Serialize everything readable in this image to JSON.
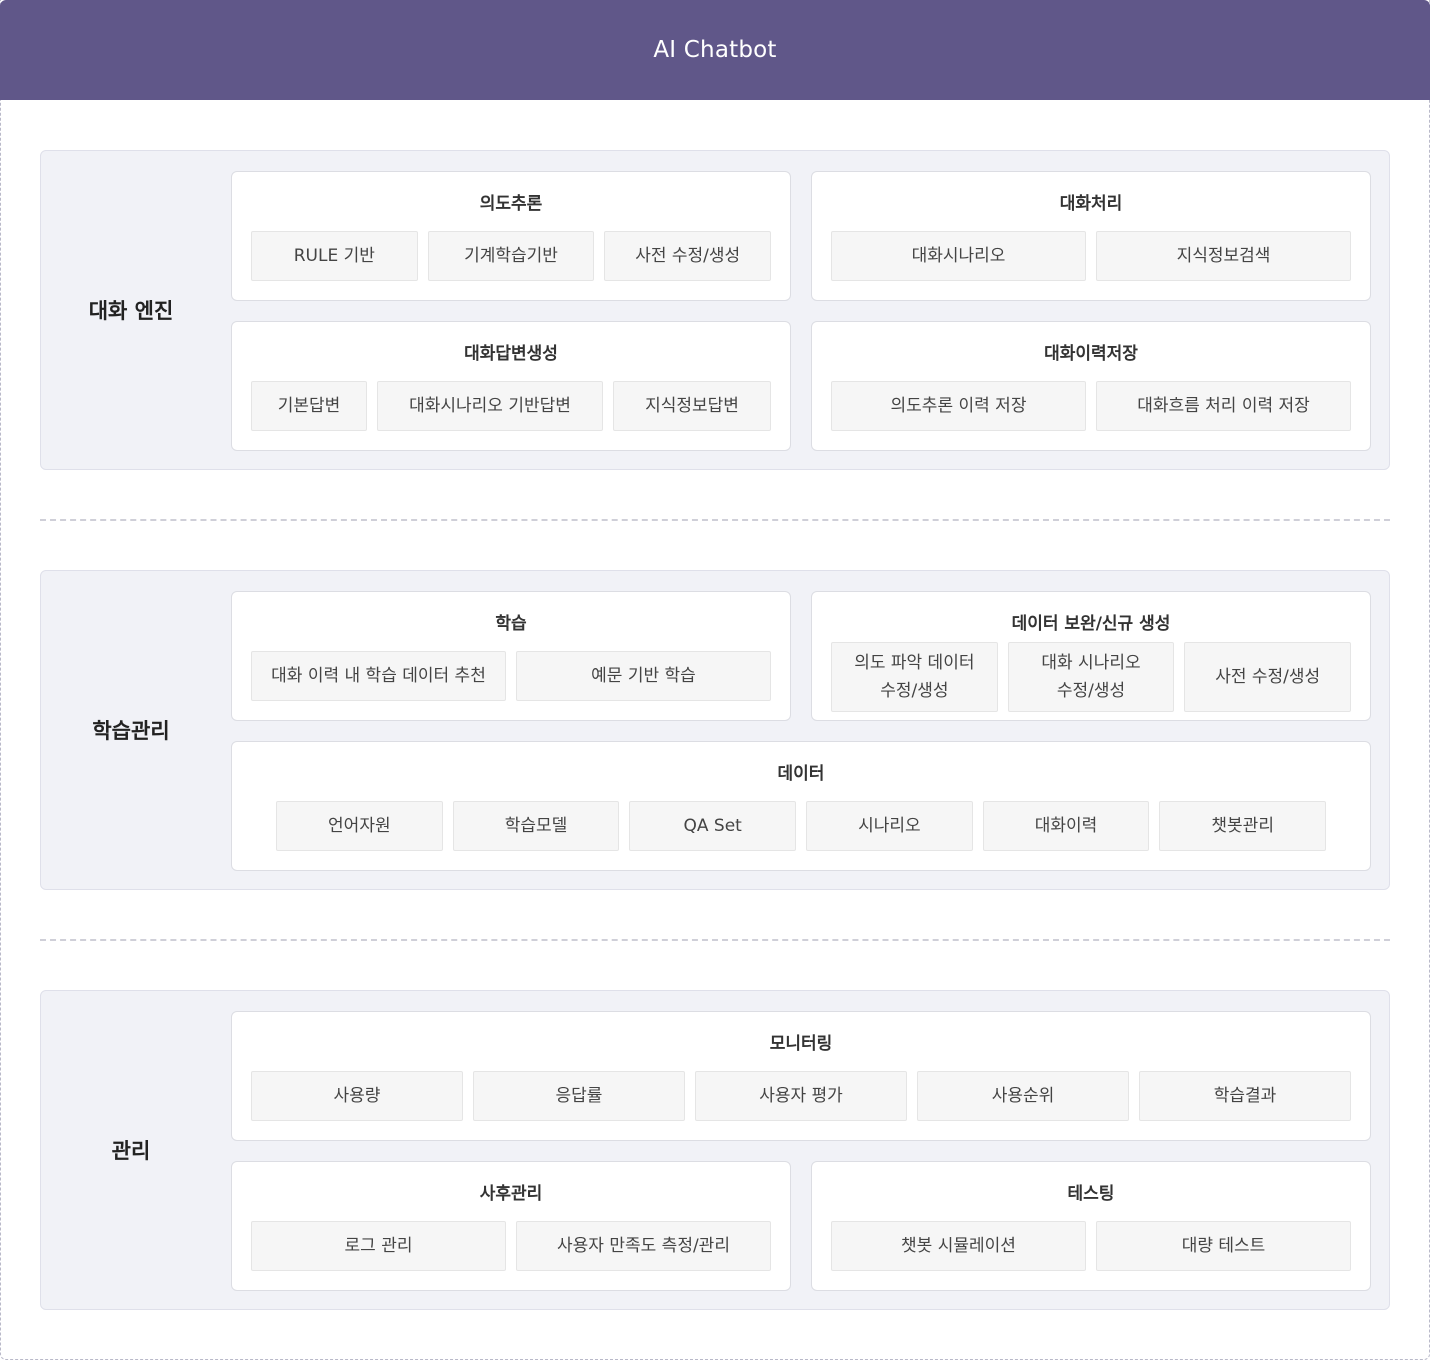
{
  "title": "AI Chatbot",
  "sections": [
    {
      "label": "대화 엔진",
      "groups": [
        {
          "title": "의도추론",
          "items": [
            "RULE 기반",
            "기계학습기반",
            "사전 수정/생성"
          ]
        },
        {
          "title": "대화처리",
          "items": [
            "대화시나리오",
            "지식정보검색"
          ]
        },
        {
          "title": "대화답변생성",
          "items": [
            "기본답변",
            "대화시나리오 기반답변",
            "지식정보답변"
          ]
        },
        {
          "title": "대화이력저장",
          "items": [
            "의도추론 이력 저장",
            "대화흐름 처리 이력 저장"
          ]
        }
      ]
    },
    {
      "label": "학습관리",
      "groups": [
        {
          "title": "학습",
          "items": [
            "대화 이력 내 학습 데이터 추천",
            "예문 기반 학습"
          ]
        },
        {
          "title": "데이터 보완/신규 생성",
          "items": [
            "의도 파악 데이터\n수정/생성",
            "대화 시나리오\n수정/생성",
            "사전 수정/생성"
          ]
        },
        {
          "title": "데이터",
          "items": [
            "언어자원",
            "학습모델",
            "QA Set",
            "시나리오",
            "대화이력",
            "챗봇관리"
          ]
        }
      ]
    },
    {
      "label": "관리",
      "groups": [
        {
          "title": "모니터링",
          "items": [
            "사용량",
            "응답률",
            "사용자 평가",
            "사용순위",
            "학습결과"
          ]
        },
        {
          "title": "사후관리",
          "items": [
            "로그 관리",
            "사용자 만족도 측정/관리"
          ]
        },
        {
          "title": "테스팅",
          "items": [
            "챗봇 시뮬레이션",
            "대량 테스트"
          ]
        }
      ]
    }
  ]
}
